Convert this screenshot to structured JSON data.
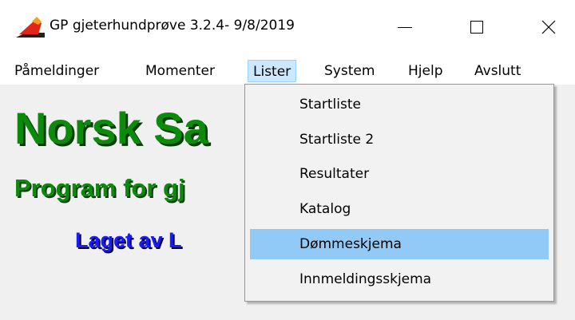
{
  "window": {
    "title": "GP gjeterhundprøve 3.2.4- 9/8/2019",
    "icon": "red-arrow-app-icon"
  },
  "menubar": {
    "items": [
      "Påmeldinger",
      "Momenter",
      "Lister",
      "System",
      "Hjelp",
      "Avslutt"
    ],
    "active": "Lister"
  },
  "content": {
    "heading": "Norsk Sa",
    "subheading": "Program for gj",
    "author": "Laget av L",
    "heading_color": "#0b8a0b",
    "author_color": "#1a1aff"
  },
  "dropdown": {
    "items": [
      "Startliste",
      "Startliste 2",
      "Resultater",
      "Katalog",
      "Dømmeskjema",
      "Innmeldingsskjema"
    ],
    "highlighted": "Dømmeskjema",
    "highlight_color": "#91c9f7"
  }
}
